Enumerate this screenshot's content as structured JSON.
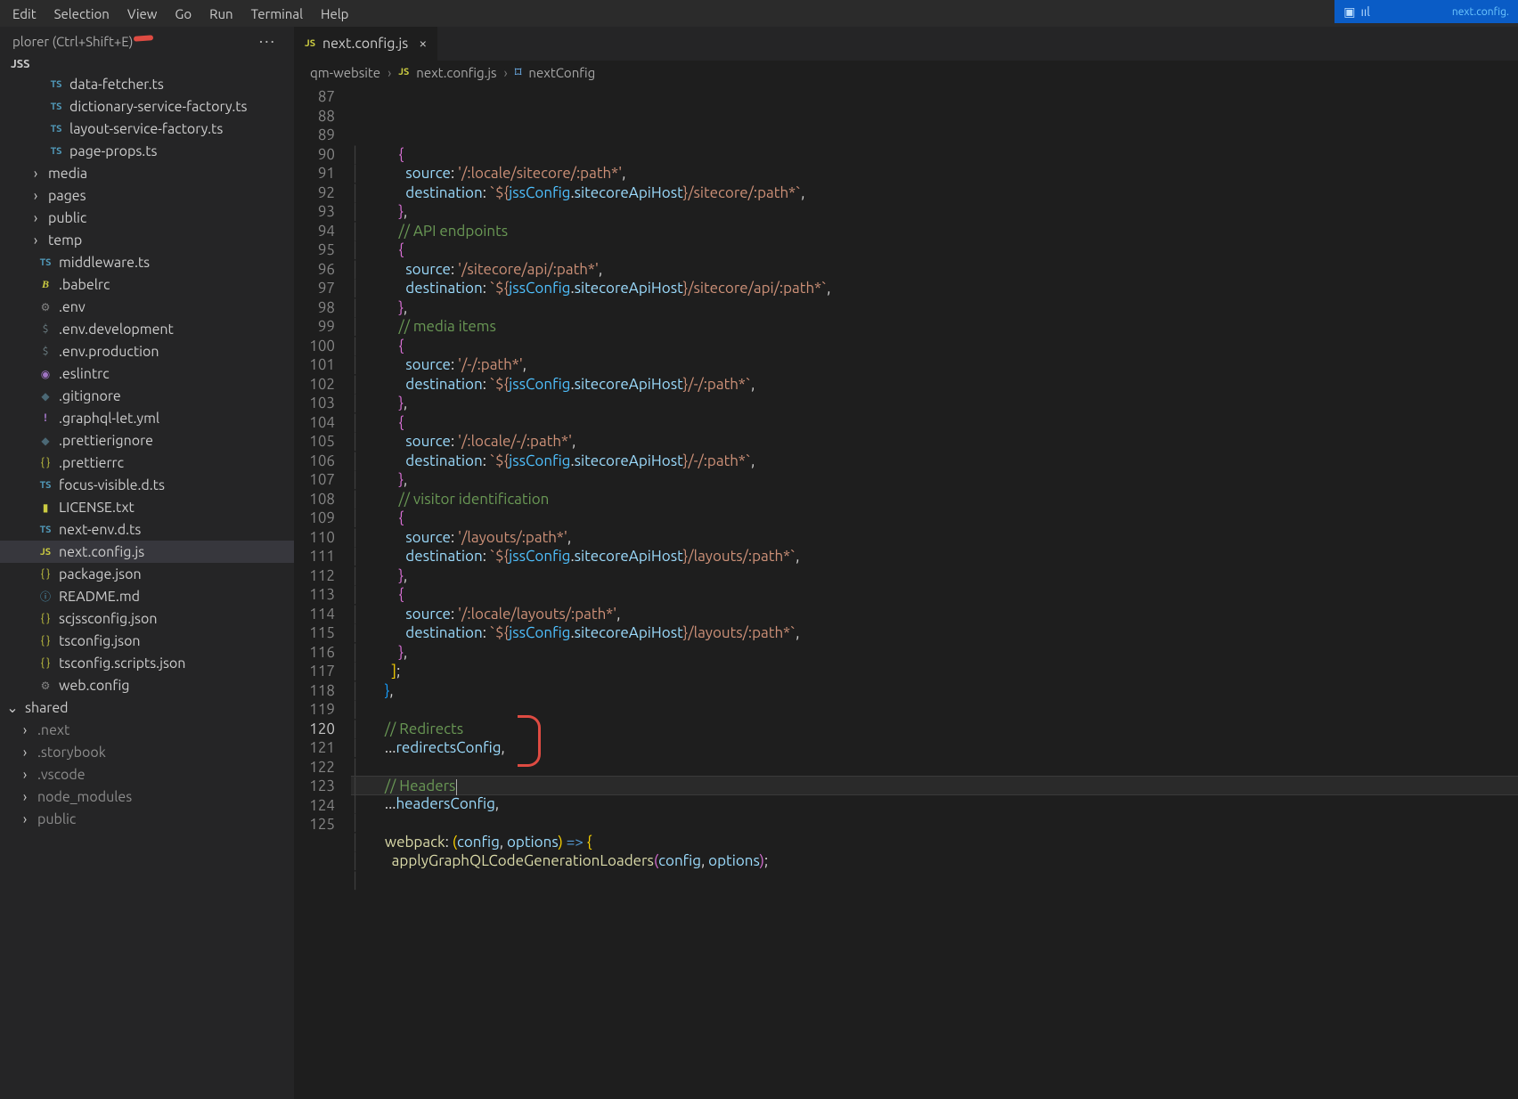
{
  "menu": {
    "items": [
      "Edit",
      "Selection",
      "View",
      "Go",
      "Run",
      "Terminal",
      "Help"
    ]
  },
  "remoteTab": {
    "label": "next.config."
  },
  "explorer": {
    "header": "plorer (Ctrl+Shift+E)",
    "section": "JSS",
    "tree": [
      {
        "icon": "ts",
        "label": "data-fetcher.ts",
        "depth": 1
      },
      {
        "icon": "ts",
        "label": "dictionary-service-factory.ts",
        "depth": 1
      },
      {
        "icon": "ts",
        "label": "layout-service-factory.ts",
        "depth": 1
      },
      {
        "icon": "ts",
        "label": "page-props.ts",
        "depth": 1
      },
      {
        "icon": "folder",
        "label": "media",
        "depth": 1,
        "chev": ">"
      },
      {
        "icon": "folder",
        "label": "pages",
        "depth": 1,
        "chev": ">"
      },
      {
        "icon": "folder",
        "label": "public",
        "depth": 1,
        "chev": ">"
      },
      {
        "icon": "folder",
        "label": "temp",
        "depth": 1,
        "chev": ">"
      },
      {
        "icon": "ts",
        "label": "middleware.ts",
        "depth": 0
      },
      {
        "icon": "babel",
        "label": ".babelrc",
        "depth": 0
      },
      {
        "icon": "gear",
        "label": ".env",
        "depth": 0
      },
      {
        "icon": "dollar",
        "label": ".env.development",
        "depth": 0
      },
      {
        "icon": "dollar",
        "label": ".env.production",
        "depth": 0
      },
      {
        "icon": "purple",
        "label": ".eslintrc",
        "depth": 0
      },
      {
        "icon": "git",
        "label": ".gitignore",
        "depth": 0
      },
      {
        "icon": "bang",
        "label": ".graphql-let.yml",
        "depth": 0
      },
      {
        "icon": "git",
        "label": ".prettierignore",
        "depth": 0
      },
      {
        "icon": "json",
        "label": ".prettierrc",
        "depth": 0
      },
      {
        "icon": "ts",
        "label": "focus-visible.d.ts",
        "depth": 0
      },
      {
        "icon": "license",
        "label": "LICENSE.txt",
        "depth": 0
      },
      {
        "icon": "ts",
        "label": "next-env.d.ts",
        "depth": 0
      },
      {
        "icon": "js",
        "label": "next.config.js",
        "depth": 0,
        "sel": true,
        "mark": true
      },
      {
        "icon": "json",
        "label": "package.json",
        "depth": 0
      },
      {
        "icon": "info",
        "label": "README.md",
        "depth": 0
      },
      {
        "icon": "json",
        "label": "scjssconfig.json",
        "depth": 0
      },
      {
        "icon": "json",
        "label": "tsconfig.json",
        "depth": 0
      },
      {
        "icon": "json",
        "label": "tsconfig.scripts.json",
        "depth": 0
      },
      {
        "icon": "gear",
        "label": "web.config",
        "depth": 0
      }
    ],
    "shared": {
      "label": "shared",
      "items": [
        ".next",
        ".storybook",
        ".vscode",
        "node_modules",
        "public"
      ]
    }
  },
  "tab": {
    "icon": "JS",
    "label": "next.config.js"
  },
  "breadcrumb": {
    "items": [
      "qm-website",
      "next.config.js",
      "nextConfig"
    ],
    "icons": [
      "",
      "JS",
      "cube"
    ]
  },
  "code": {
    "startLine": 87,
    "currentLine": 120,
    "lines": [
      [
        [
          "        ",
          ""
        ],
        [
          "{",
          "brace"
        ]
      ],
      [
        [
          "          ",
          ""
        ],
        [
          "source",
          "key"
        ],
        [
          ":",
          ""
        ],
        [
          " ",
          ""
        ],
        [
          "'/:locale/sitecore/:path*'",
          "str"
        ],
        [
          ",",
          ""
        ]
      ],
      [
        [
          "          ",
          ""
        ],
        [
          "destination",
          "key"
        ],
        [
          ":",
          ""
        ],
        [
          " ",
          ""
        ],
        [
          "`${",
          "tpl"
        ],
        [
          "jssConfig",
          "obj"
        ],
        [
          ".",
          ""
        ],
        [
          "sitecoreApiHost",
          "prop"
        ],
        [
          "}",
          "tpl"
        ],
        [
          "/sitecore/:path*`",
          "tpl"
        ],
        [
          ",",
          ""
        ]
      ],
      [
        [
          "        ",
          ""
        ],
        [
          "}",
          "brace"
        ],
        [
          ",",
          ""
        ]
      ],
      [
        [
          "        ",
          ""
        ],
        [
          "// API endpoints",
          "com"
        ]
      ],
      [
        [
          "        ",
          ""
        ],
        [
          "{",
          "brace"
        ]
      ],
      [
        [
          "          ",
          ""
        ],
        [
          "source",
          "key"
        ],
        [
          ":",
          ""
        ],
        [
          " ",
          ""
        ],
        [
          "'/sitecore/api/:path*'",
          "str"
        ],
        [
          ",",
          ""
        ]
      ],
      [
        [
          "          ",
          ""
        ],
        [
          "destination",
          "key"
        ],
        [
          ":",
          ""
        ],
        [
          " ",
          ""
        ],
        [
          "`${",
          "tpl"
        ],
        [
          "jssConfig",
          "obj"
        ],
        [
          ".",
          ""
        ],
        [
          "sitecoreApiHost",
          "prop"
        ],
        [
          "}",
          "tpl"
        ],
        [
          "/sitecore/api/:path*`",
          "tpl"
        ],
        [
          ",",
          ""
        ]
      ],
      [
        [
          "        ",
          ""
        ],
        [
          "}",
          "brace"
        ],
        [
          ",",
          ""
        ]
      ],
      [
        [
          "        ",
          ""
        ],
        [
          "// media items",
          "com"
        ]
      ],
      [
        [
          "        ",
          ""
        ],
        [
          "{",
          "brace"
        ]
      ],
      [
        [
          "          ",
          ""
        ],
        [
          "source",
          "key"
        ],
        [
          ":",
          ""
        ],
        [
          " ",
          ""
        ],
        [
          "'/-/:path*'",
          "str"
        ],
        [
          ",",
          ""
        ]
      ],
      [
        [
          "          ",
          ""
        ],
        [
          "destination",
          "key"
        ],
        [
          ":",
          ""
        ],
        [
          " ",
          ""
        ],
        [
          "`${",
          "tpl"
        ],
        [
          "jssConfig",
          "obj"
        ],
        [
          ".",
          ""
        ],
        [
          "sitecoreApiHost",
          "prop"
        ],
        [
          "}",
          "tpl"
        ],
        [
          "/-/:path*`",
          "tpl"
        ],
        [
          ",",
          ""
        ]
      ],
      [
        [
          "        ",
          ""
        ],
        [
          "}",
          "brace"
        ],
        [
          ",",
          ""
        ]
      ],
      [
        [
          "        ",
          ""
        ],
        [
          "{",
          "brace"
        ]
      ],
      [
        [
          "          ",
          ""
        ],
        [
          "source",
          "key"
        ],
        [
          ":",
          ""
        ],
        [
          " ",
          ""
        ],
        [
          "'/:locale/-/:path*'",
          "str"
        ],
        [
          ",",
          ""
        ]
      ],
      [
        [
          "          ",
          ""
        ],
        [
          "destination",
          "key"
        ],
        [
          ":",
          ""
        ],
        [
          " ",
          ""
        ],
        [
          "`${",
          "tpl"
        ],
        [
          "jssConfig",
          "obj"
        ],
        [
          ".",
          ""
        ],
        [
          "sitecoreApiHost",
          "prop"
        ],
        [
          "}",
          "tpl"
        ],
        [
          "/-/:path*`",
          "tpl"
        ],
        [
          ",",
          ""
        ]
      ],
      [
        [
          "        ",
          ""
        ],
        [
          "}",
          "brace"
        ],
        [
          ",",
          ""
        ]
      ],
      [
        [
          "        ",
          ""
        ],
        [
          "// visitor identification",
          "com"
        ]
      ],
      [
        [
          "        ",
          ""
        ],
        [
          "{",
          "brace"
        ]
      ],
      [
        [
          "          ",
          ""
        ],
        [
          "source",
          "key"
        ],
        [
          ":",
          ""
        ],
        [
          " ",
          ""
        ],
        [
          "'/layouts/:path*'",
          "str"
        ],
        [
          ",",
          ""
        ]
      ],
      [
        [
          "          ",
          ""
        ],
        [
          "destination",
          "key"
        ],
        [
          ":",
          ""
        ],
        [
          " ",
          ""
        ],
        [
          "`${",
          "tpl"
        ],
        [
          "jssConfig",
          "obj"
        ],
        [
          ".",
          ""
        ],
        [
          "sitecoreApiHost",
          "prop"
        ],
        [
          "}",
          "tpl"
        ],
        [
          "/layouts/:path*`",
          "tpl"
        ],
        [
          ",",
          ""
        ]
      ],
      [
        [
          "        ",
          ""
        ],
        [
          "}",
          "brace"
        ],
        [
          ",",
          ""
        ]
      ],
      [
        [
          "        ",
          ""
        ],
        [
          "{",
          "brace"
        ]
      ],
      [
        [
          "          ",
          ""
        ],
        [
          "source",
          "key"
        ],
        [
          ":",
          ""
        ],
        [
          " ",
          ""
        ],
        [
          "'/:locale/layouts/:path*'",
          "str"
        ],
        [
          ",",
          ""
        ]
      ],
      [
        [
          "          ",
          ""
        ],
        [
          "destination",
          "key"
        ],
        [
          ":",
          ""
        ],
        [
          " ",
          ""
        ],
        [
          "`${",
          "tpl"
        ],
        [
          "jssConfig",
          "obj"
        ],
        [
          ".",
          ""
        ],
        [
          "sitecoreApiHost",
          "prop"
        ],
        [
          "}",
          "tpl"
        ],
        [
          "/layouts/:path*`",
          "tpl"
        ],
        [
          ",",
          ""
        ]
      ],
      [
        [
          "        ",
          ""
        ],
        [
          "}",
          "brace"
        ],
        [
          ",",
          ""
        ]
      ],
      [
        [
          "      ",
          ""
        ],
        [
          "]",
          "brkt"
        ],
        [
          ";",
          ""
        ]
      ],
      [
        [
          "    ",
          ""
        ],
        [
          "}",
          "brace2"
        ],
        [
          ",",
          ""
        ]
      ],
      [
        [
          "",
          ""
        ]
      ],
      [
        [
          "    ",
          ""
        ],
        [
          "// Redirects",
          "com"
        ]
      ],
      [
        [
          "    ",
          ""
        ],
        [
          "...",
          ""
        ],
        [
          "redirectsConfig",
          "var"
        ],
        [
          ",",
          ""
        ]
      ],
      [
        [
          "",
          ""
        ]
      ],
      [
        [
          "    ",
          ""
        ],
        [
          "// Headers",
          "com"
        ]
      ],
      [
        [
          "    ",
          ""
        ],
        [
          "...",
          ""
        ],
        [
          "headersConfig",
          "var"
        ],
        [
          ",",
          ""
        ]
      ],
      [
        [
          "",
          ""
        ]
      ],
      [
        [
          "    ",
          ""
        ],
        [
          "webpack",
          "fn"
        ],
        [
          ":",
          ""
        ],
        [
          " ",
          ""
        ],
        [
          "(",
          "brace3"
        ],
        [
          "config",
          "var"
        ],
        [
          ", ",
          ""
        ],
        [
          "options",
          "var"
        ],
        [
          ")",
          "brace3"
        ],
        [
          " ",
          ""
        ],
        [
          "=>",
          "kw"
        ],
        [
          " ",
          ""
        ],
        [
          "{",
          "brace3"
        ]
      ],
      [
        [
          "      ",
          ""
        ],
        [
          "applyGraphQLCodeGenerationLoaders",
          "fn"
        ],
        [
          "(",
          "brace"
        ],
        [
          "config",
          "var"
        ],
        [
          ", ",
          ""
        ],
        [
          "options",
          "var"
        ],
        [
          ")",
          "brace"
        ],
        [
          ";",
          ""
        ]
      ],
      [
        [
          "",
          ""
        ]
      ]
    ]
  }
}
